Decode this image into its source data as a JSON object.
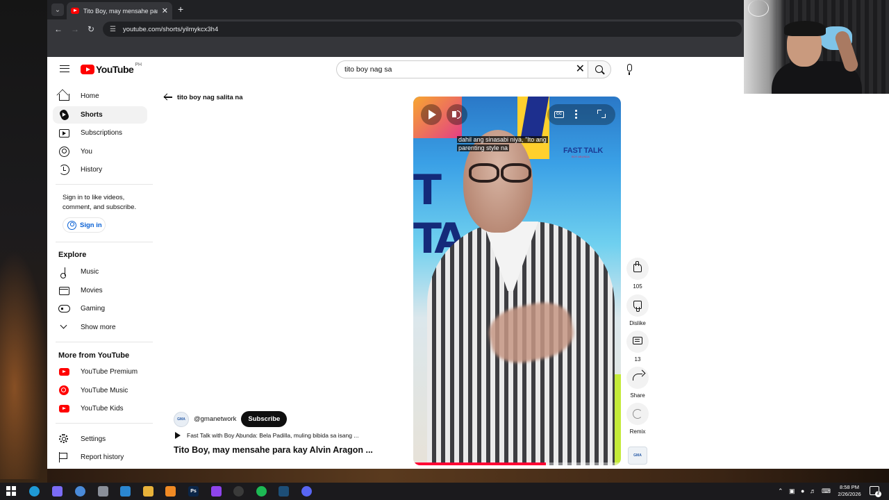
{
  "browser": {
    "tab_title": "Tito Boy, may mensahe para kay Alvin Aragon - YouTube",
    "url": "youtube.com/shorts/yilmykcx3h4"
  },
  "masthead": {
    "logo_text": "YouTube",
    "country_code": "PH",
    "search_value": "tito boy nag sa"
  },
  "sidebar": {
    "primary": [
      {
        "label": "Home",
        "icon": "home-icon"
      },
      {
        "label": "Shorts",
        "icon": "shorts-icon",
        "active": true
      },
      {
        "label": "Subscriptions",
        "icon": "subscriptions-icon"
      },
      {
        "label": "You",
        "icon": "you-icon"
      },
      {
        "label": "History",
        "icon": "history-icon"
      }
    ],
    "signin_prompt": "Sign in to like videos, comment, and subscribe.",
    "signin_label": "Sign in",
    "explore_title": "Explore",
    "explore": [
      {
        "label": "Music",
        "icon": "music-icon"
      },
      {
        "label": "Movies",
        "icon": "movies-icon"
      },
      {
        "label": "Gaming",
        "icon": "gaming-icon"
      },
      {
        "label": "Show more",
        "icon": "chevron-down-icon"
      }
    ],
    "more_title": "More from YouTube",
    "more": [
      {
        "label": "YouTube Premium",
        "icon": "youtube-premium-icon"
      },
      {
        "label": "YouTube Music",
        "icon": "youtube-music-icon"
      },
      {
        "label": "YouTube Kids",
        "icon": "youtube-kids-icon"
      }
    ],
    "footer": [
      {
        "label": "Settings",
        "icon": "gear-icon"
      },
      {
        "label": "Report history",
        "icon": "flag-icon"
      }
    ]
  },
  "shorts": {
    "back_label": "tito boy nag salita na",
    "channel_avatar_text": "GMA",
    "channel_name": "@gmanetwork",
    "subscribe_label": "Subscribe",
    "related_label": "Fast Talk with Boy Abunda: Bela Padilla, muling bibida sa isang ...",
    "title": "Tito Boy, may mensahe para kay Alvin Aragon ...",
    "caption_line1": "dahil ang sinasabi niya, \"Ito ang",
    "caption_line2": "parenting style na",
    "set_letters": "T TA",
    "set_logo": "FAST TALK",
    "set_logo_sub": "BOY ABUNDA",
    "cc_label": "CC",
    "progress": 0.64,
    "progress_color": "#ff0033",
    "actions": {
      "like_count": "105",
      "dislike_label": "Dislike",
      "comment_count": "13",
      "share_label": "Share",
      "remix_label": "Remix"
    },
    "pivot_text": "GMA"
  },
  "taskbar": {
    "time": "8:58 PM",
    "date": "2/26/2026",
    "notification_count": "2",
    "apps": [
      {
        "name": "edge-icon",
        "color": "#1f9ad6"
      },
      {
        "name": "copilot-icon",
        "color": "#7b6cf6"
      },
      {
        "name": "chrome-icon",
        "color": "#4a8ad8"
      },
      {
        "name": "cleaner-icon",
        "color": "#8a8f99"
      },
      {
        "name": "vscode-icon",
        "color": "#2b87d1"
      },
      {
        "name": "file-explorer-icon",
        "color": "#e8b23a"
      },
      {
        "name": "sublime-icon",
        "color": "#f08a24"
      },
      {
        "name": "photoshop-icon",
        "color": "#0b2547",
        "text": "Ps"
      },
      {
        "name": "twitch-icon",
        "color": "#8e44ec"
      },
      {
        "name": "obs-icon",
        "color": "#3a3a3a"
      },
      {
        "name": "spotify-icon",
        "color": "#1db954"
      },
      {
        "name": "steam-icon",
        "color": "#1d4e77"
      },
      {
        "name": "discord-icon",
        "color": "#5865f2"
      }
    ]
  }
}
